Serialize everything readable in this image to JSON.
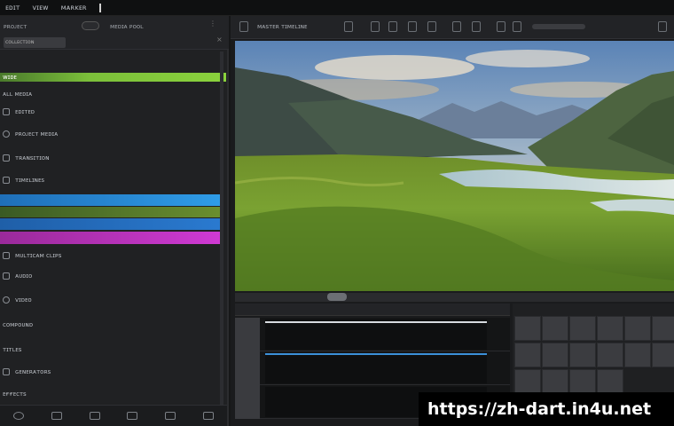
{
  "menubar": {
    "items": [
      "ᴇᴅɪᴛ",
      "ᴠɪᴇᴡ",
      "ᴍᴀʀᴋᴇʀ"
    ]
  },
  "left_panel": {
    "header_left": "ᴘʀᴏᴊᴇᴄᴛ",
    "header_right": "ᴍᴇᴅɪᴀ ᴘᴏᴏʟ",
    "sub_label": "ᴄᴏʟʟᴇᴄᴛɪᴏɴ",
    "green_bar_label": "ᴡɪᴅᴇ",
    "rows": [
      "ᴀʟʟ ᴍᴇᴅɪᴀ",
      "ᴇᴅɪᴛᴇᴅ",
      "ᴘʀᴏᴊᴇᴄᴛ ᴍᴇᴅɪᴀ",
      "ᴛʀᴀɴsɪᴛɪᴏɴ",
      "ᴛɪᴍᴇʟɪɴᴇs"
    ],
    "rows_lower": [
      "ᴍᴜʟᴛɪᴄᴀᴍ ᴄʟɪᴘs",
      "ᴀᴜᴅɪᴏ",
      "ᴠɪᴅᴇᴏ",
      "ᴄᴏᴍᴘᴏᴜɴᴅ",
      "ᴛɪᴛʟᴇs",
      "ɢᴇɴᴇʀᴀᴛᴏʀs",
      "ᴇғғᴇᴄᴛs"
    ]
  },
  "viewer": {
    "title": "ᴍᴀsᴛᴇʀ ᴛɪᴍᴇʟɪɴᴇ"
  },
  "watermark": {
    "url": "https://zh-dart.in4u.net"
  }
}
